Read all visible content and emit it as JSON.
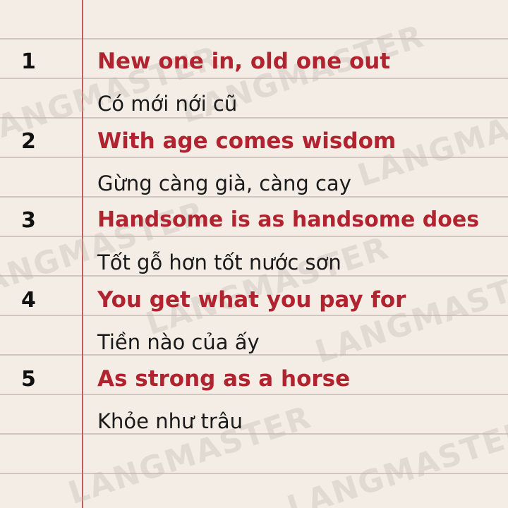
{
  "watermark": "LANGMASTER",
  "colors": {
    "english": "#b22330",
    "vietnamese": "#1a1a1a",
    "number": "#111111",
    "margin_line": "#c8595a",
    "paper": "#f4ede6"
  },
  "items": [
    {
      "number": "1",
      "english": "New one in, old one out",
      "vietnamese": "Có mới nới cũ"
    },
    {
      "number": "2",
      "english": "With age comes wisdom",
      "vietnamese": "Gừng càng già, càng cay"
    },
    {
      "number": "3",
      "english": "Handsome is as handsome does",
      "vietnamese": "Tốt gỗ hơn tốt nước sơn"
    },
    {
      "number": "4",
      "english": "You get what you pay for",
      "vietnamese": "Tiền nào của ấy"
    },
    {
      "number": "5",
      "english": "As strong as a horse",
      "vietnamese": "Khỏe như trâu"
    }
  ]
}
